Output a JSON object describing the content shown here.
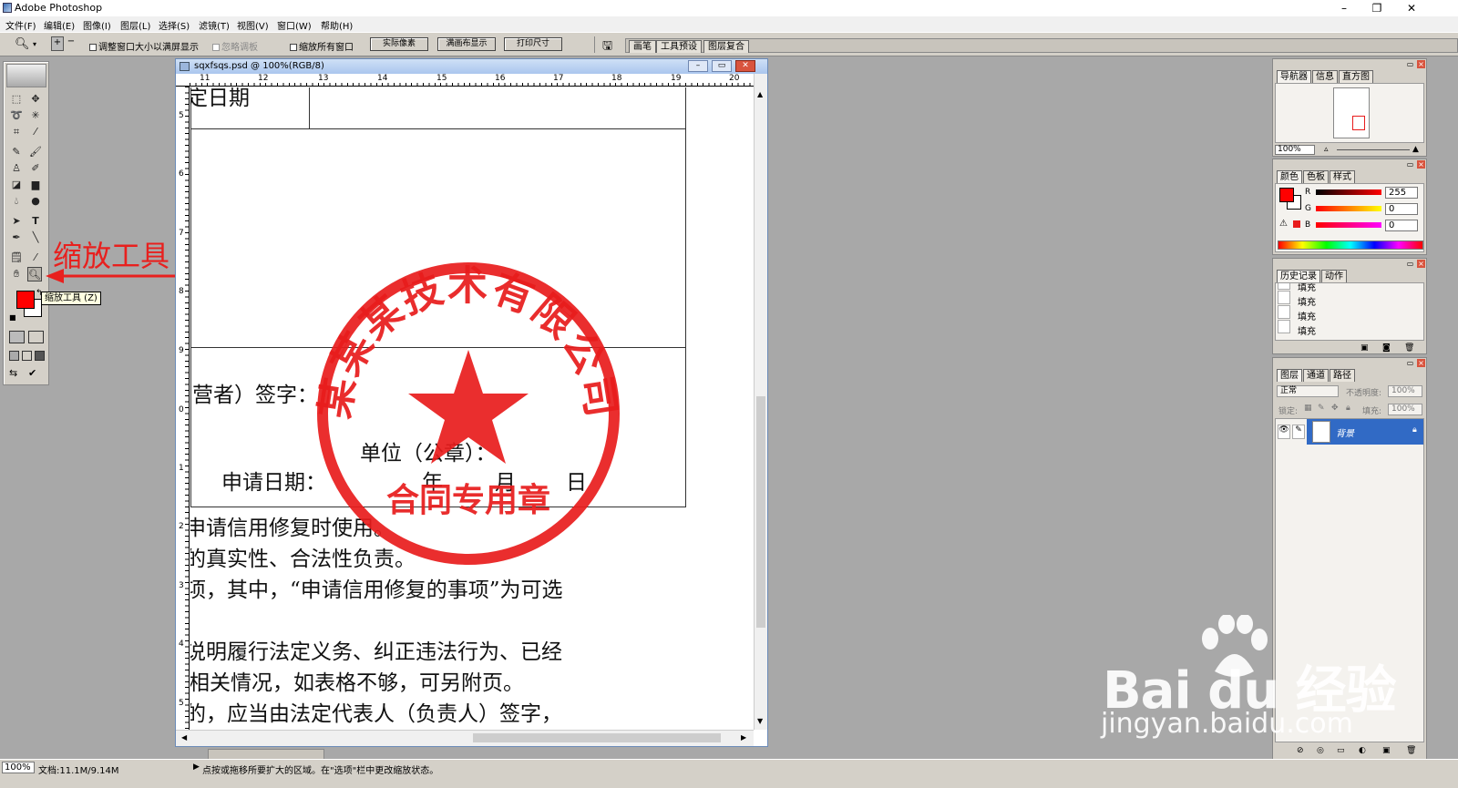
{
  "app": {
    "title": "Adobe Photoshop",
    "window_buttons": [
      "–",
      "❐",
      "✕"
    ]
  },
  "menu": [
    "文件(F)",
    "编辑(E)",
    "图像(I)",
    "图层(L)",
    "选择(S)",
    "滤镜(T)",
    "视图(V)",
    "窗口(W)",
    "帮助(H)"
  ],
  "options_bar": {
    "resize_window": "调整窗口大小以满屏显示",
    "ignore_palettes": "忽略调板",
    "zoom_all_windows": "缩放所有窗口",
    "actual_pixels": "实际像素",
    "fit_on_screen": "满画布显示",
    "print_size": "打印尺寸",
    "well_tabs": [
      "画笔",
      "工具预设",
      "图层复合"
    ]
  },
  "document": {
    "title": "sqxfsqs.psd @ 100%(RGB/8)",
    "ruler_top": [
      "11",
      "12",
      "13",
      "14",
      "15",
      "16",
      "17",
      "18",
      "19",
      "20"
    ],
    "ruler_left": [
      "5",
      "6",
      "7",
      "8",
      "9",
      "0",
      "1",
      "2",
      "3",
      "4",
      "5"
    ],
    "lines": {
      "top_cell": "定日期",
      "signature": "营者）签字：",
      "unit": "单位（公章）：",
      "apply_date": "申请日期：",
      "year": "年",
      "month": "月",
      "day": "日",
      "p1": "申请信用修复时使用。",
      "p2": "的真实性、合法性负责。",
      "p3": "项，其中，“申请信用修复的事项”为可选",
      "p4": "说明履行法定义务、纠正违法行为、已经",
      "p5": "相关情况，如表格不够，可另附页。",
      "p6": "的，应当由法定代表人（负责人）签字，"
    },
    "stamp": {
      "company": "某某某技术有限公司",
      "purpose": "合同专用章",
      "color": "#e81c1c"
    }
  },
  "annotation": {
    "label": "缩放工具",
    "tooltip": "缩放工具 (Z)",
    "color": "#e8201e"
  },
  "panels": {
    "navigator": {
      "tabs": [
        "导航器",
        "信息",
        "直方图"
      ],
      "zoom": "100%"
    },
    "color": {
      "tabs": [
        "颜色",
        "色板",
        "样式"
      ],
      "r_label": "R",
      "g_label": "G",
      "b_label": "B",
      "r": "255",
      "g": "0",
      "b": "0",
      "foreground": "#ff0000"
    },
    "history": {
      "tabs": [
        "历史记录",
        "动作"
      ],
      "items": [
        "填充",
        "填充",
        "填充",
        "填充"
      ]
    },
    "layers": {
      "tabs": [
        "图层",
        "通道",
        "路径"
      ],
      "blend_mode": "正常",
      "opacity_label": "不透明度:",
      "opacity": "100%",
      "lock_label": "锁定:",
      "fill_label": "填充:",
      "fill": "100%",
      "layer_name": "背景"
    }
  },
  "status": {
    "zoom": "100%",
    "doc_info": "文档:11.1M/9.14M",
    "hint": "点按或拖移所要扩大的区域。在\"选项\"栏中更改缩放状态。"
  },
  "watermark": {
    "brand": "Bai du 经验",
    "url": "jingyan.baidu.com"
  }
}
